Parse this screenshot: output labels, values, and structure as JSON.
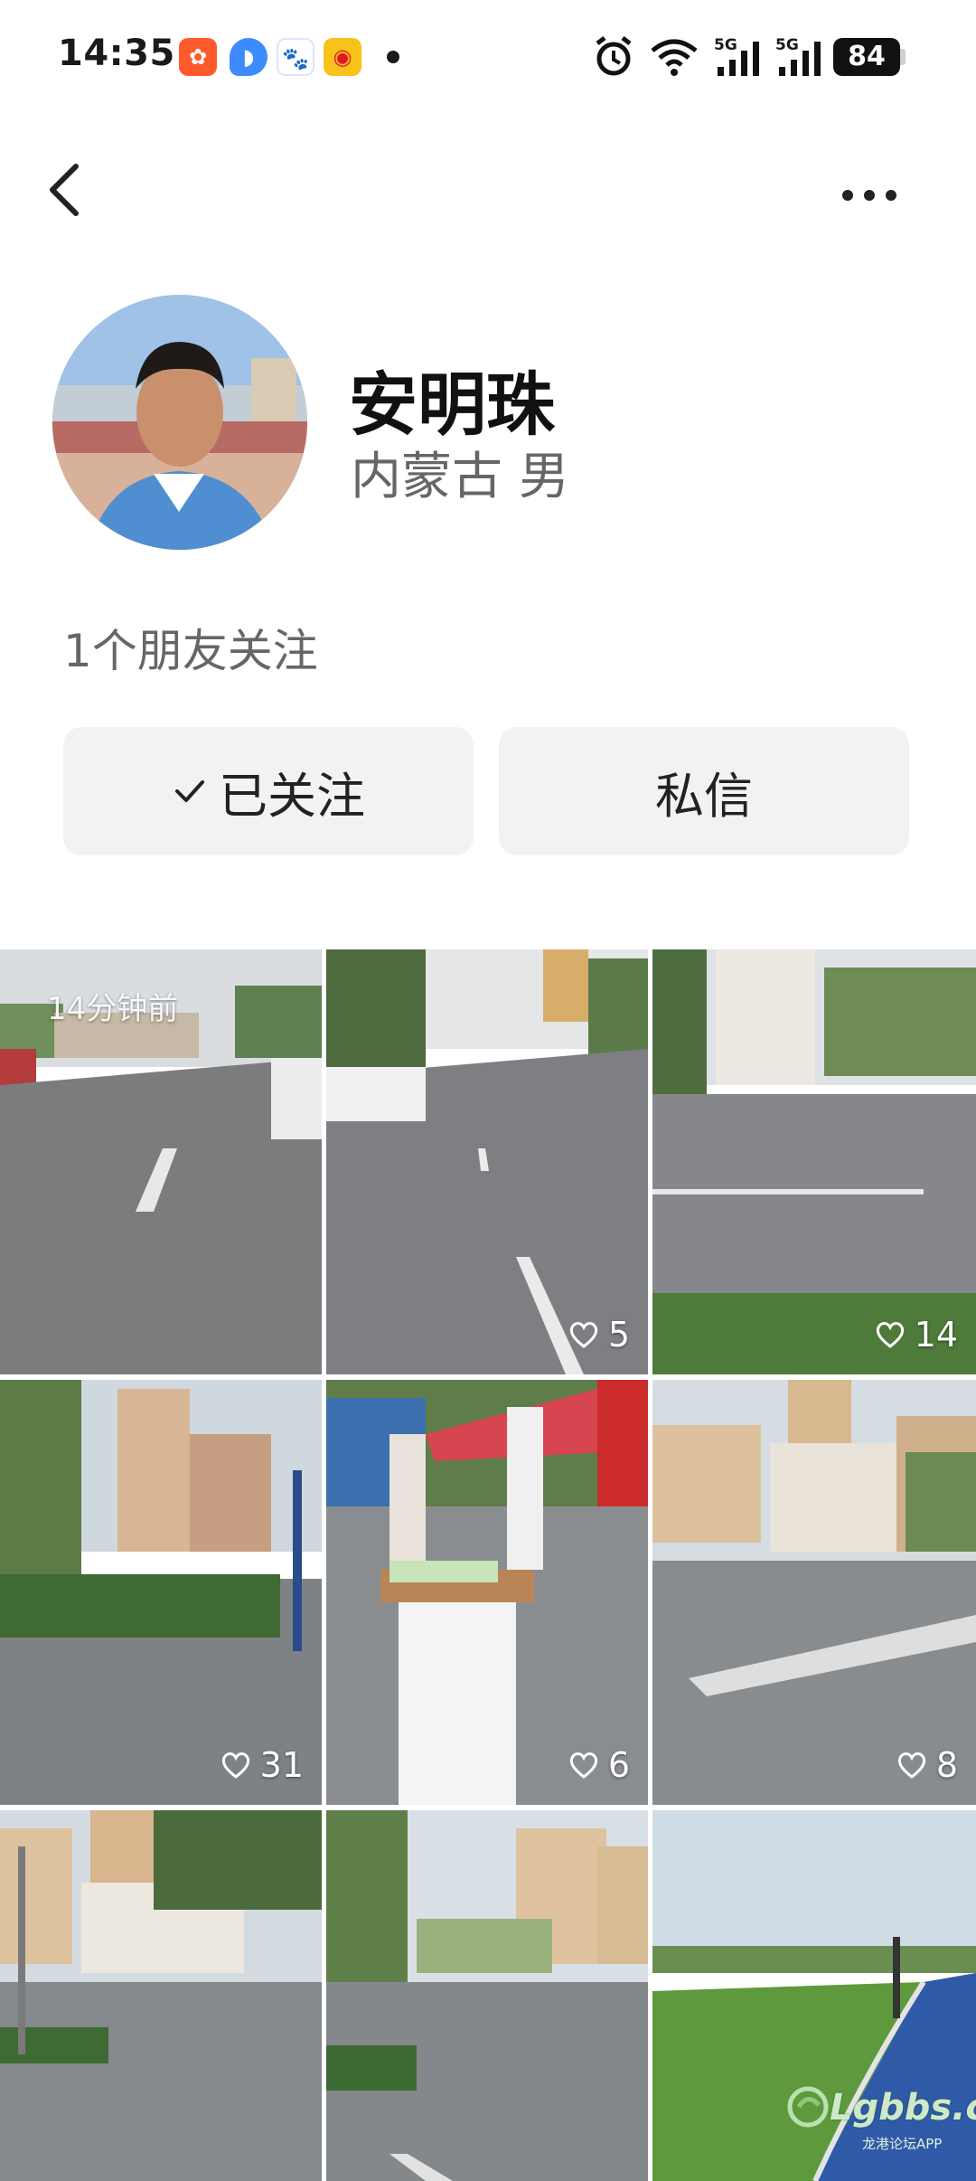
{
  "status_bar": {
    "time": "14:35",
    "signal_label_1": "5G",
    "signal_label_2": "5G",
    "battery": "84",
    "icons": [
      "xiaohongshu-icon",
      "browser-icon",
      "baidu-icon",
      "weibo-icon",
      "alarm-icon",
      "wifi-icon",
      "signal-icon",
      "battery-icon"
    ]
  },
  "nav": {
    "back_icon": "chevron-left-icon",
    "more_icon": "more-dots-icon"
  },
  "profile": {
    "name": "安明珠",
    "region": "内蒙古",
    "gender": "男",
    "friends_follow": "1个朋友关注",
    "follow_button": "已关注",
    "message_button": "私信"
  },
  "posts": [
    {
      "badge": "14分钟前",
      "likes": ""
    },
    {
      "badge": "",
      "likes": "5"
    },
    {
      "badge": "",
      "likes": "14"
    },
    {
      "badge": "",
      "likes": "31"
    },
    {
      "badge": "",
      "likes": "6"
    },
    {
      "badge": "",
      "likes": "8"
    },
    {
      "badge": "",
      "likes": ""
    },
    {
      "badge": "",
      "likes": ""
    },
    {
      "badge": "",
      "likes": ""
    }
  ],
  "watermark": {
    "logo_text": "Lgbbs.cn",
    "sub_text": "龙港论坛APP"
  },
  "colors": {
    "button_bg": "#f2f2f2",
    "secondary_text": "#666666",
    "primary_text": "#111111"
  }
}
